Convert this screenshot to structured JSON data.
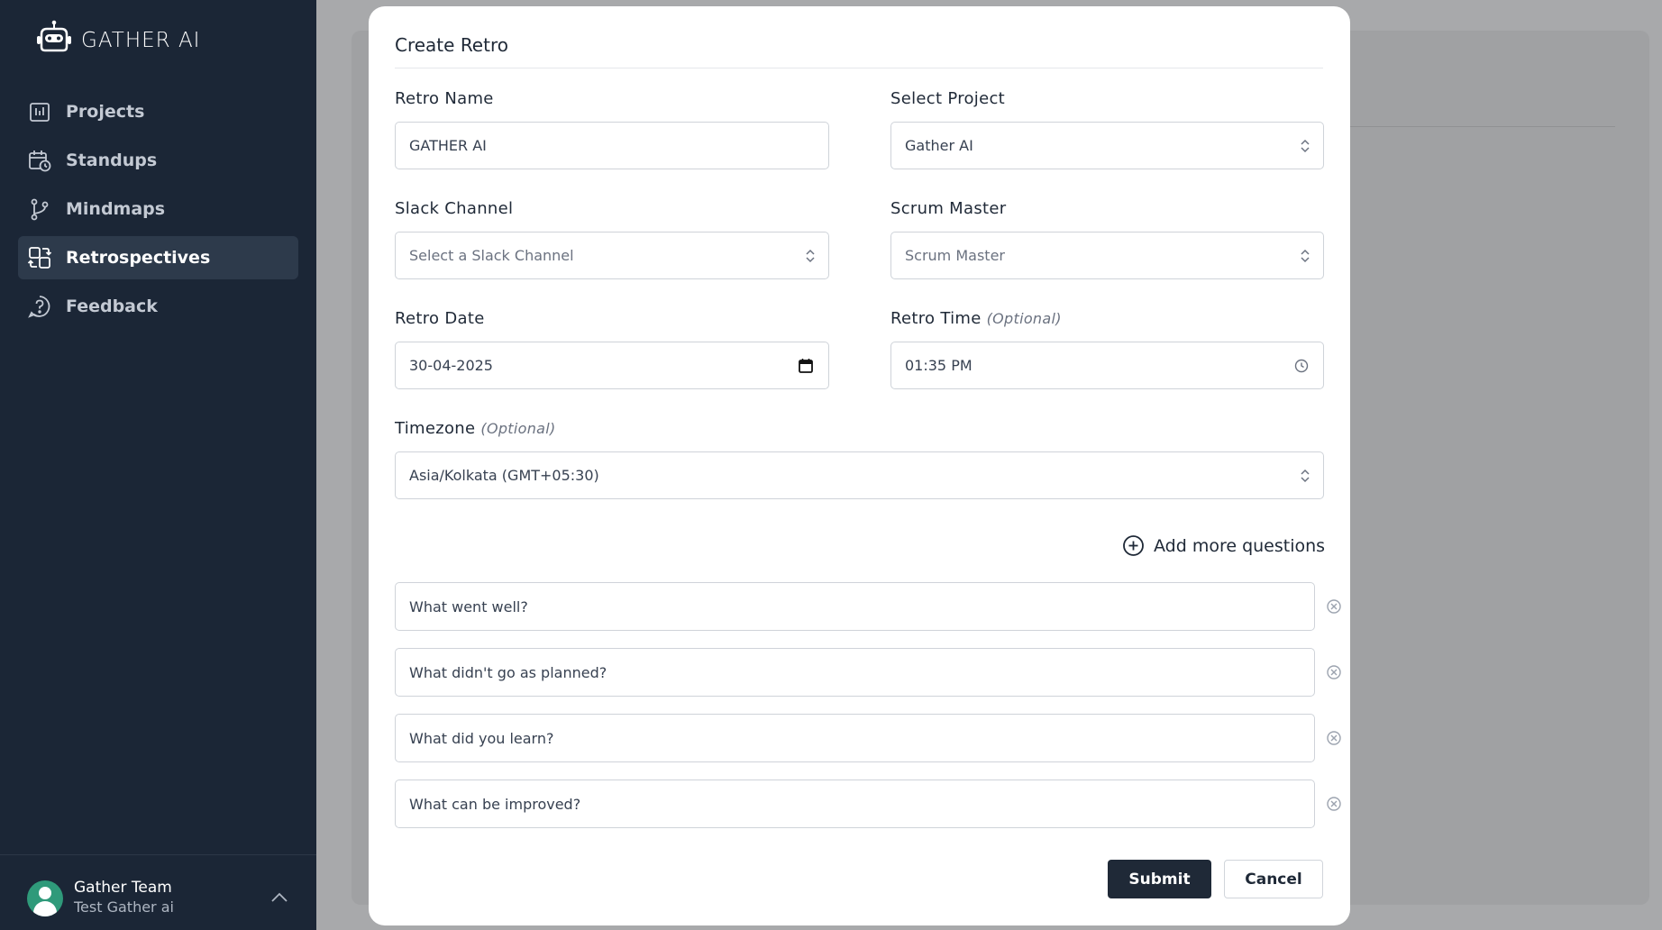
{
  "app": {
    "name": "GATHER AI"
  },
  "sidebar": {
    "items": [
      {
        "label": "Projects",
        "icon": "projects-icon",
        "active": false
      },
      {
        "label": "Standups",
        "icon": "calendar-clock-icon",
        "active": false
      },
      {
        "label": "Mindmaps",
        "icon": "git-branch-icon",
        "active": false
      },
      {
        "label": "Retrospectives",
        "icon": "retro-icon",
        "active": true
      },
      {
        "label": "Feedback",
        "icon": "help-bubble-icon",
        "active": false
      }
    ],
    "user": {
      "name": "Gather Team",
      "subtitle": "Test Gather ai"
    }
  },
  "modal": {
    "title": "Create Retro",
    "retro_name": {
      "label": "Retro Name",
      "value": "GATHER AI"
    },
    "select_project": {
      "label": "Select Project",
      "value": "Gather AI"
    },
    "slack_channel": {
      "label": "Slack Channel",
      "placeholder": "Select a Slack Channel"
    },
    "scrum_master": {
      "label": "Scrum Master",
      "placeholder": "Scrum Master"
    },
    "retro_date": {
      "label": "Retro Date",
      "value": "30-04-2025"
    },
    "retro_time": {
      "label": "Retro Time",
      "optional": "(Optional)",
      "value": "01:35 PM"
    },
    "timezone": {
      "label": "Timezone",
      "optional": "(Optional)",
      "value": "Asia/Kolkata (GMT+05:30)"
    },
    "add_questions_label": "Add more questions",
    "questions": [
      "What went well?",
      "What didn't go as planned?",
      "What did you learn?",
      "What can be improved?"
    ],
    "submit_label": "Submit",
    "cancel_label": "Cancel"
  },
  "colors": {
    "sidebar_bg": "#1b2636",
    "primary_button": "#1f2937",
    "overlay": "#a8a9ab"
  }
}
